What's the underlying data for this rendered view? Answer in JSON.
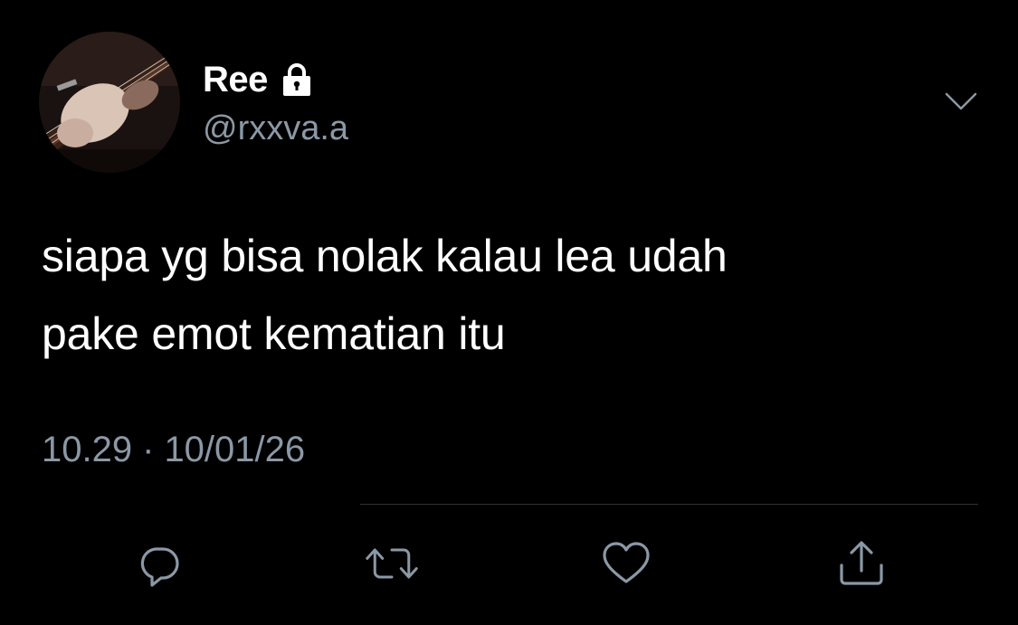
{
  "tweet": {
    "author": {
      "display_name": "Ree",
      "handle": "@rxxva.a",
      "protected_icon": "lock-icon",
      "avatar_icon": "avatar-guitar-photo"
    },
    "menu_icon": "chevron-down-icon",
    "text_lines": [
      "siapa yg bisa nolak kalau lea udah",
      "pake emot kematian itu"
    ],
    "time": "10.29",
    "separator": "·",
    "date": "10/01/26"
  },
  "actions": [
    {
      "name": "reply",
      "icon": "reply-icon"
    },
    {
      "name": "retweet",
      "icon": "retweet-icon"
    },
    {
      "name": "like",
      "icon": "heart-icon"
    },
    {
      "name": "share",
      "icon": "share-icon"
    }
  ],
  "colors": {
    "background": "#000000",
    "primary_text": "#ffffff",
    "secondary_text": "#8b98a5",
    "divider": "#2f3336"
  }
}
